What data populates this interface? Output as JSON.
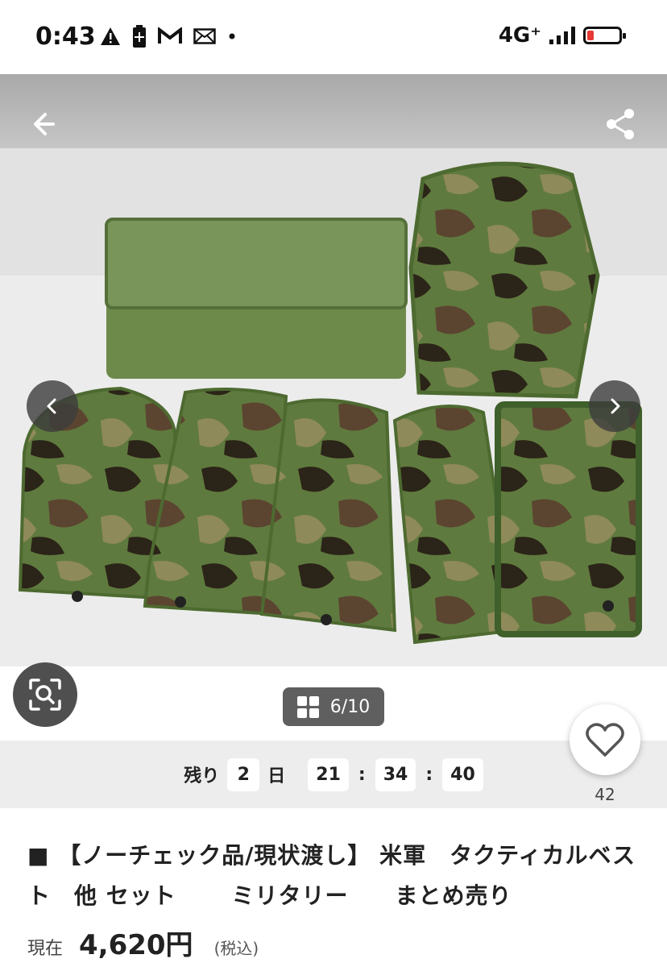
{
  "status_bar": {
    "time": "0:43",
    "network": "4G⁺",
    "icons": [
      "warning-icon",
      "battery-saver-icon",
      "gmail-icon",
      "mail-icon",
      "more-dot-icon",
      "signal-icon",
      "battery-low-icon"
    ]
  },
  "header": {
    "back_icon": "arrow-left-icon",
    "share_icon": "share-icon"
  },
  "gallery": {
    "counter": "6/10",
    "prev_icon": "chevron-left-icon",
    "next_icon": "chevron-right-icon",
    "image_description_hidden": null
  },
  "timer": {
    "label": "残り",
    "days": "2",
    "day_unit": "日",
    "hours": "21",
    "minutes": "34",
    "seconds": "40",
    "separator": ":"
  },
  "favorite": {
    "count": "42"
  },
  "listing": {
    "title": "■ 【ノーチェック品/現状渡し】 米軍　タクティカルベスト　他 セット　　 ミリタリー　　まとめ売り",
    "price_label": "現在",
    "price": "4,620円",
    "tax_note": "(税込)"
  },
  "colors": {
    "accent_battery": "#e53935",
    "overlay_dark": "#4f4f4f",
    "timer_bg": "#ededed"
  }
}
